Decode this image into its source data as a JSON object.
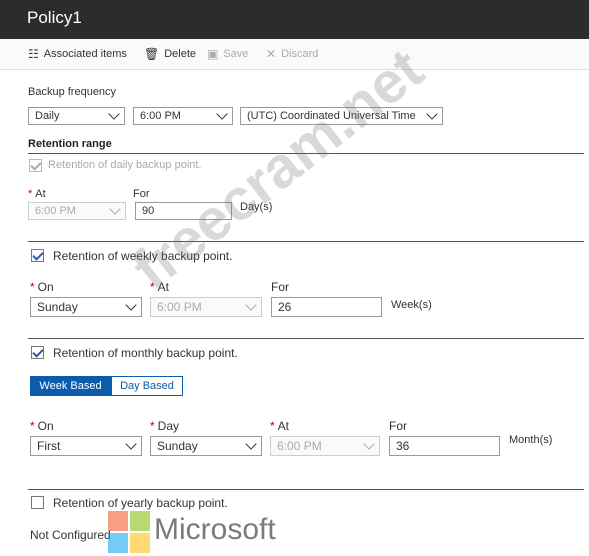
{
  "title": "Policy1",
  "toolbar": {
    "associated_items": "Associated items",
    "delete": "Delete",
    "save": "Save",
    "discard": "Discard"
  },
  "backup_frequency": {
    "label": "Backup frequency",
    "frequency": "Daily",
    "time": "6:00 PM",
    "timezone": "(UTC) Coordinated Universal Time"
  },
  "retention_range_label": "Retention range",
  "daily": {
    "label": "Retention of daily backup point.",
    "checked": true,
    "at_label": "At",
    "for_label": "For",
    "at_value": "6:00 PM",
    "for_value": "90",
    "unit": "Day(s)"
  },
  "weekly": {
    "label": "Retention of weekly backup point.",
    "checked": true,
    "on_label": "On",
    "at_label": "At",
    "for_label": "For",
    "on_value": "Sunday",
    "at_value": "6:00 PM",
    "for_value": "26",
    "unit": "Week(s)"
  },
  "monthly": {
    "label": "Retention of monthly backup point.",
    "checked": true,
    "tab_week": "Week Based",
    "tab_day": "Day Based",
    "selected_tab": "Week Based",
    "on_label": "On",
    "day_label": "Day",
    "at_label": "At",
    "for_label": "For",
    "on_value": "First",
    "day_value": "Sunday",
    "at_value": "6:00 PM",
    "for_value": "36",
    "unit": "Month(s)"
  },
  "yearly": {
    "label": "Retention of yearly backup point.",
    "checked": false,
    "status": "Not Configured"
  },
  "watermark": "freecram.net",
  "brand": "Microsoft",
  "colors": {
    "accent": "#0b5cab",
    "titlebar": "#2c2c2c",
    "required": "#cc0000"
  }
}
